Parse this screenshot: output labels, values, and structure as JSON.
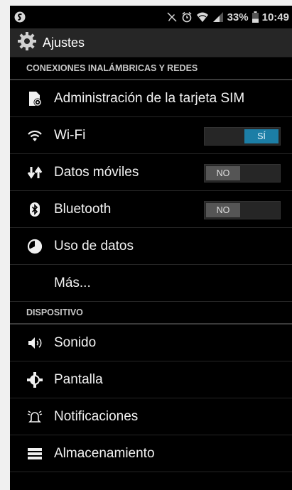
{
  "status_bar": {
    "battery_percent": "33%",
    "time": "10:49",
    "icons": [
      "sync-icon",
      "mute-icon",
      "alarm-icon",
      "wifi-icon",
      "signal-icon",
      "battery-icon"
    ]
  },
  "action_bar": {
    "title": "Ajustes",
    "icon": "gear-icon"
  },
  "sections": {
    "wireless": {
      "header": "CONEXIONES INALÁMBRICAS Y REDES",
      "items": [
        {
          "label": "Administración de la tarjeta SIM",
          "icon": "sim-card-icon"
        },
        {
          "label": "Wi-Fi",
          "icon": "wifi-icon",
          "toggle": "SÍ"
        },
        {
          "label": "Datos móviles",
          "icon": "data-arrows-icon",
          "toggle": "NO"
        },
        {
          "label": "Bluetooth",
          "icon": "bluetooth-icon",
          "toggle": "NO"
        },
        {
          "label": "Uso de datos",
          "icon": "pie-chart-icon"
        },
        {
          "label": "Más..."
        }
      ]
    },
    "device": {
      "header": "DISPOSITIVO",
      "items": [
        {
          "label": "Sonido",
          "icon": "speaker-icon"
        },
        {
          "label": "Pantalla",
          "icon": "brightness-icon"
        },
        {
          "label": "Notificaciones",
          "icon": "bell-icon"
        },
        {
          "label": "Almacenamiento",
          "icon": "storage-icon"
        }
      ]
    }
  },
  "colors": {
    "background": "#000000",
    "actionbar": "#262626",
    "toggle_on": "#1c7ea6",
    "toggle_off": "#555555"
  }
}
